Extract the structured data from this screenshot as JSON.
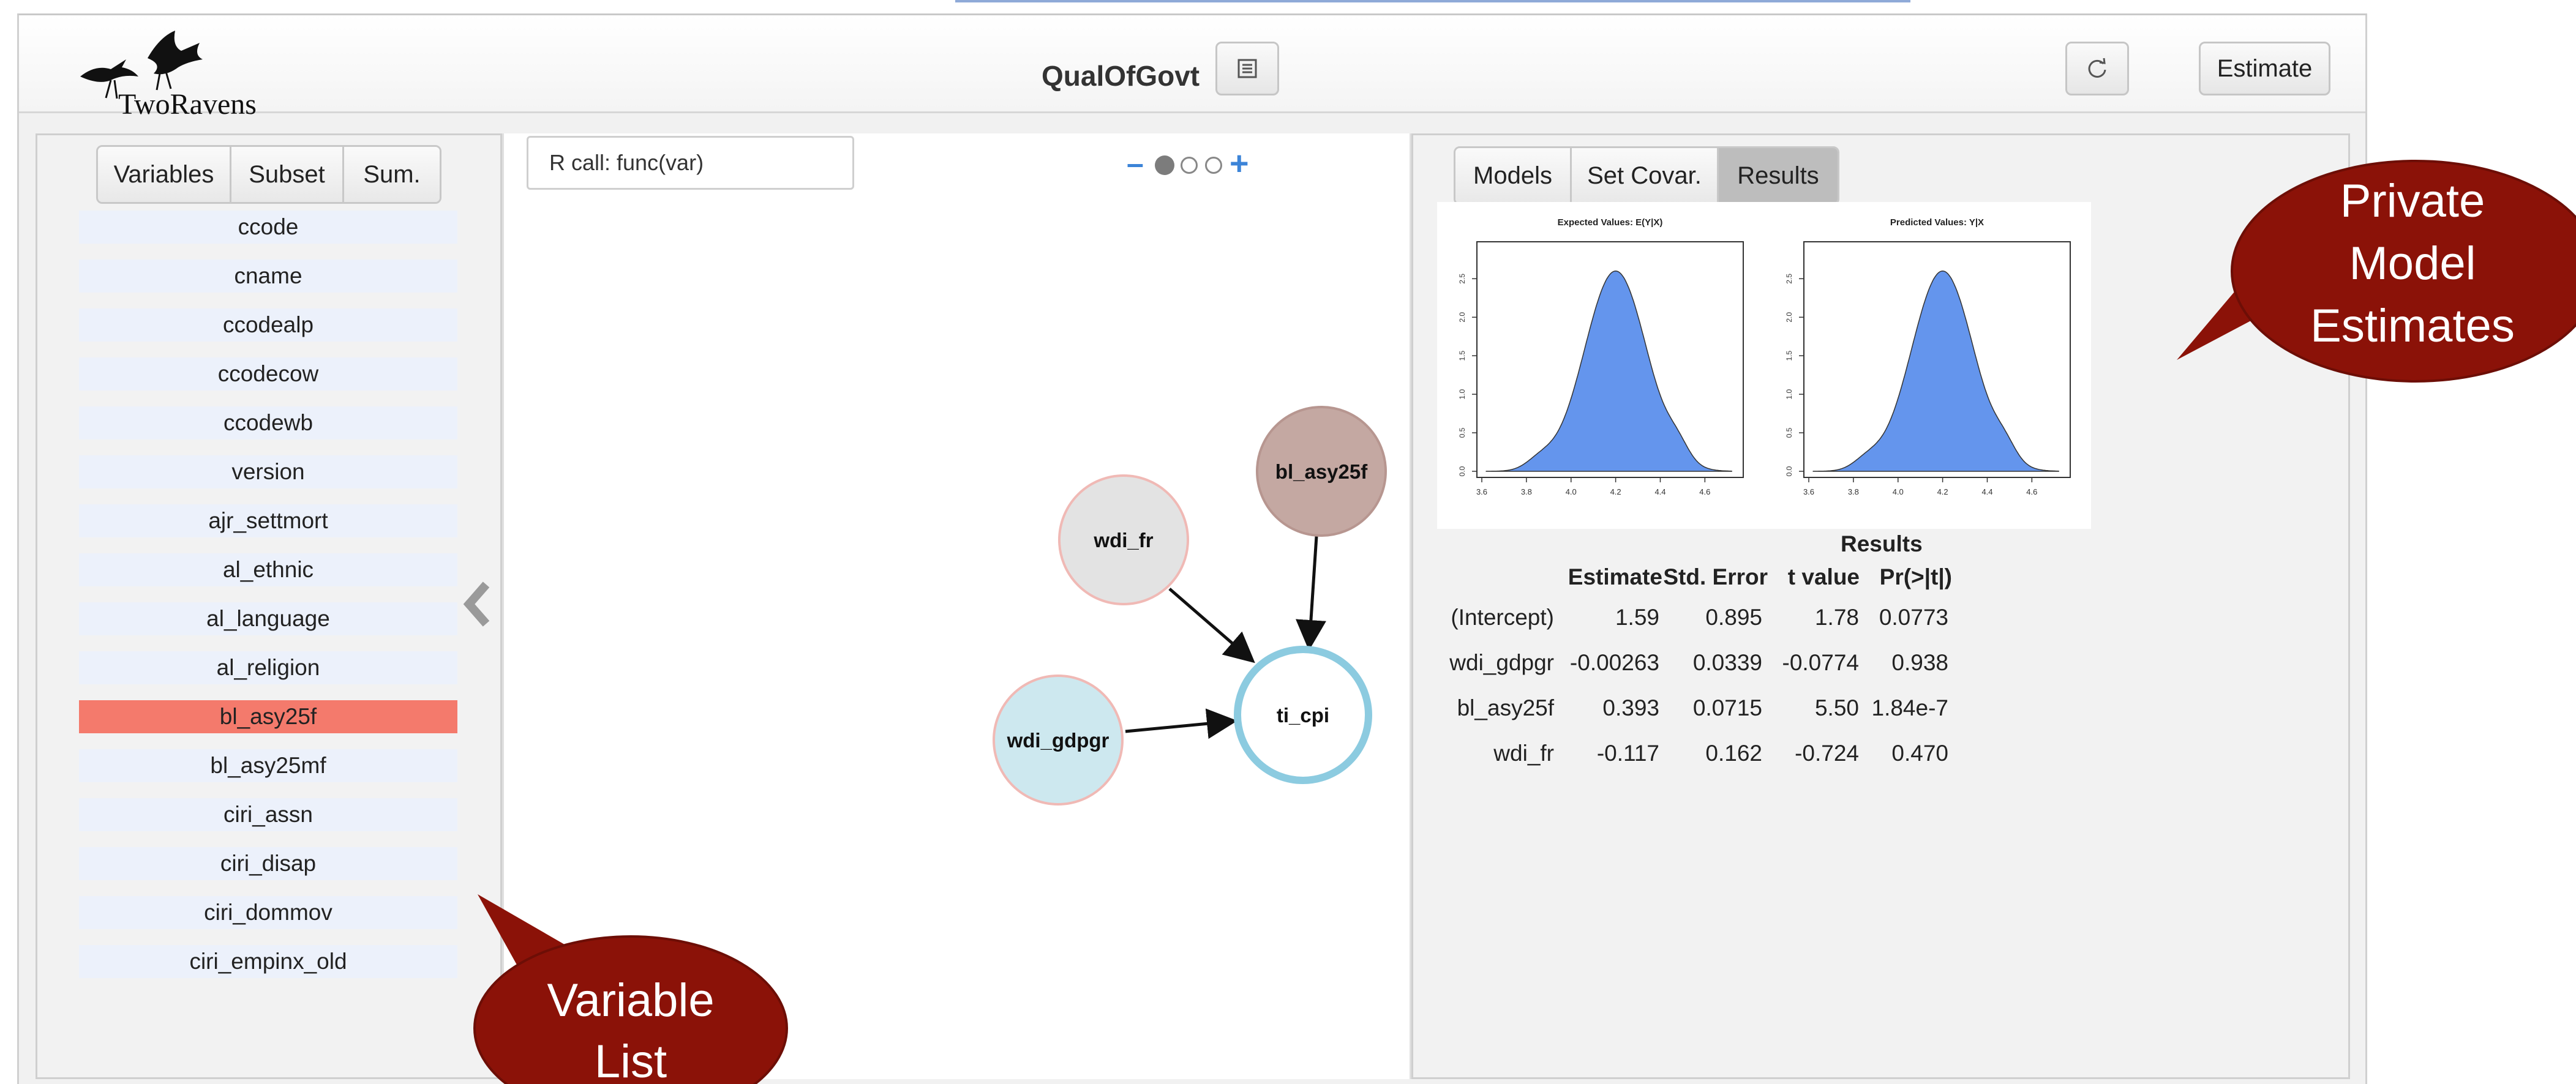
{
  "app": {
    "logo_text": "TwoRavens",
    "title": "QualOfGovt"
  },
  "toolbar": {
    "notes_icon": "list-icon",
    "reset_icon": "refresh-icon",
    "estimate_label": "Estimate"
  },
  "left_panel": {
    "tabs": [
      {
        "label": "Variables",
        "active": true
      },
      {
        "label": "Subset",
        "active": false
      },
      {
        "label": "Sum.",
        "active": false
      }
    ],
    "variables": [
      {
        "name": "ccode",
        "selected": false
      },
      {
        "name": "cname",
        "selected": false
      },
      {
        "name": "ccodealp",
        "selected": false
      },
      {
        "name": "ccodecow",
        "selected": false
      },
      {
        "name": "ccodewb",
        "selected": false
      },
      {
        "name": "version",
        "selected": false
      },
      {
        "name": "ajr_settmort",
        "selected": false
      },
      {
        "name": "al_ethnic",
        "selected": false
      },
      {
        "name": "al_language",
        "selected": false
      },
      {
        "name": "al_religion",
        "selected": false
      },
      {
        "name": "bl_asy25f",
        "selected": true
      },
      {
        "name": "bl_asy25mf",
        "selected": false
      },
      {
        "name": "ciri_assn",
        "selected": false
      },
      {
        "name": "ciri_disap",
        "selected": false
      },
      {
        "name": "ciri_dommov",
        "selected": false
      },
      {
        "name": "ciri_empinx_old",
        "selected": false
      }
    ],
    "collapse_icon": "chevron-left-icon"
  },
  "center": {
    "rcall_text": "R call: func(var)",
    "zoom": {
      "minus": "–",
      "plus": "+",
      "dots": 3,
      "active_dot": 0
    },
    "nodes": [
      {
        "id": "wdi_fr",
        "label": "wdi_fr",
        "fill": "#e3e3e3",
        "stroke": "#f0b9b5"
      },
      {
        "id": "bl_asy25f",
        "label": "bl_asy25f",
        "fill": "#c4a8a2",
        "stroke": "#b79690"
      },
      {
        "id": "wdi_gdpgr",
        "label": "wdi_gdpgr",
        "fill": "#cde8ef",
        "stroke": "#f0b9b5"
      },
      {
        "id": "ti_cpi",
        "label": "ti_cpi",
        "fill": "#ffffff",
        "stroke": "#8ccbe0"
      }
    ]
  },
  "right_panel": {
    "tabs": [
      {
        "label": "Models",
        "active": false
      },
      {
        "label": "Set Covar.",
        "active": false
      },
      {
        "label": "Results",
        "active": true
      }
    ],
    "expand_icon": "chevron-right-icon",
    "plot1_title": "Expected Values: E(Y|X)",
    "plot2_title": "Predicted Values: Y|X",
    "x_ticks": [
      "3.6",
      "3.8",
      "4.0",
      "4.2",
      "4.4",
      "4.6"
    ],
    "y_ticks": [
      "0.0",
      "0.5",
      "1.0",
      "1.5",
      "2.0",
      "2.5"
    ],
    "plot_color": "#6495ed",
    "results_title": "Results",
    "columns": [
      "Estimate",
      "Std. Error",
      "t value",
      "Pr(>|t|)"
    ],
    "rows": [
      {
        "name": "(Intercept)",
        "values": [
          "1.59",
          "0.895",
          "1.78",
          "0.0773"
        ]
      },
      {
        "name": "wdi_gdpgr",
        "values": [
          "-0.00263",
          "0.0339",
          "-0.0774",
          "0.938"
        ]
      },
      {
        "name": "bl_asy25f",
        "values": [
          "0.393",
          "0.0715",
          "5.50",
          "1.84e-7"
        ]
      },
      {
        "name": "wdi_fr",
        "values": [
          "-0.117",
          "0.162",
          "-0.724",
          "0.470"
        ]
      }
    ]
  },
  "callouts": {
    "model_lines": [
      "Private",
      "Model",
      "Estimates"
    ],
    "variable_lines": [
      "Variable",
      "List"
    ],
    "color": "#8b1208"
  }
}
